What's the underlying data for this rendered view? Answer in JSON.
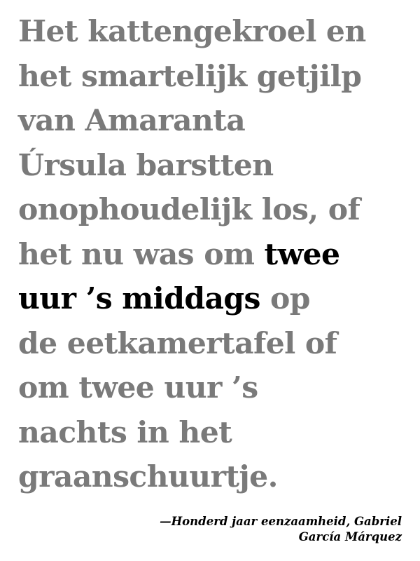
{
  "quote": {
    "lines": [
      "Het kattengekroel en",
      "het smartelijk getjilp",
      "van Amaranta",
      "Úrsula barstten",
      "onophoudelijk los, of",
      "het nu was om ",
      "twee",
      "uur ’s middags",
      " op",
      "de eetkamertafel of",
      "om twee uur ’s",
      "nachts in het",
      "graanschuurtje."
    ]
  },
  "attribution": {
    "line1": "—Honderd jaar eenzaamheid, Gabriel",
    "line2": "García Márquez"
  },
  "colors": {
    "text_muted": "#7a7a7a",
    "text_highlight": "#000000",
    "background": "#ffffff"
  }
}
